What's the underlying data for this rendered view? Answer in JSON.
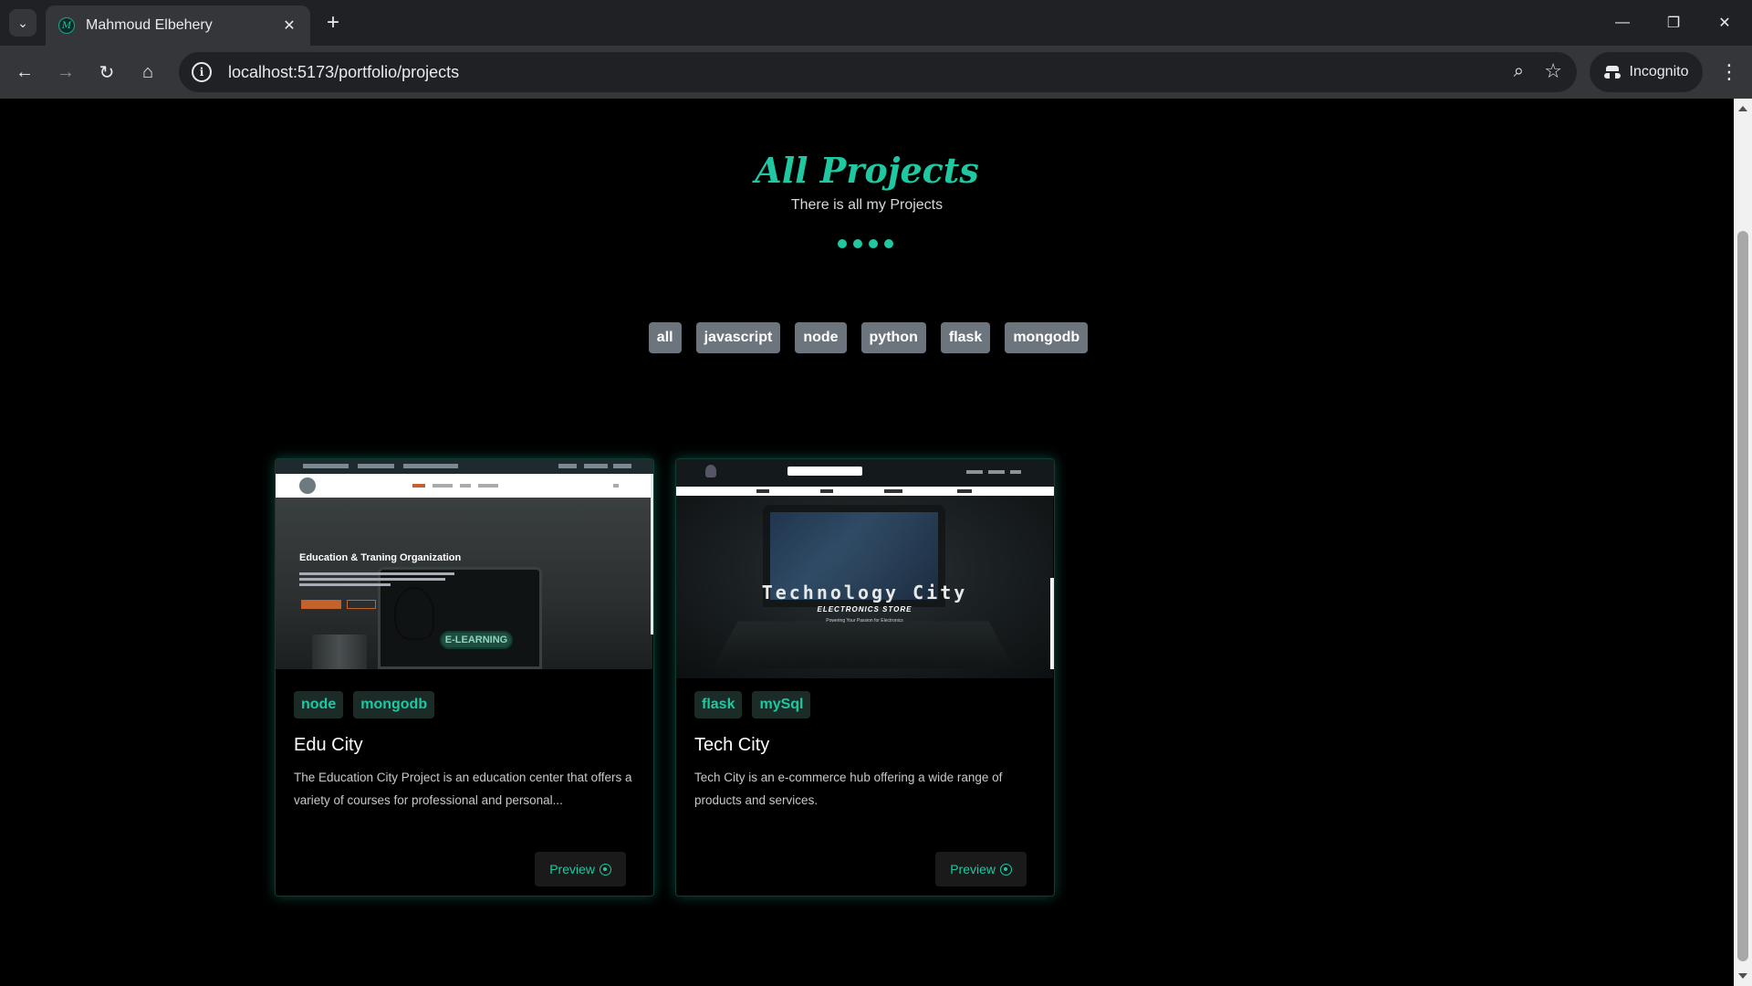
{
  "browser": {
    "tab_title": "Mahmoud Elbehery",
    "url": "localhost:5173/portfolio/projects",
    "incognito_label": "Incognito"
  },
  "page": {
    "title": "All Projects",
    "subtitle": "There is all my Projects",
    "filters": [
      "all",
      "javascript",
      "node",
      "python",
      "flask",
      "mongodb"
    ]
  },
  "projects": [
    {
      "title": "Edu City",
      "tags": [
        "node",
        "mongodb"
      ],
      "description": "The Education City Project is an education center that offers a variety of courses for professional and personal...",
      "preview_label": "Preview",
      "thumbnail": {
        "heading": "Education & Traning Organization",
        "badge": "E-LEARNING"
      }
    },
    {
      "title": "Tech City",
      "tags": [
        "flask",
        "mySql"
      ],
      "description": "Tech City is an e-commerce hub offering a wide range of products and services.",
      "preview_label": "Preview",
      "thumbnail": {
        "heading": "Technology City",
        "subheading": "ELECTRONICS STORE",
        "tagline": "Powering Your Passion for Electronics"
      }
    }
  ],
  "colors": {
    "accent": "#1fc8a0",
    "filter_bg": "#6c757d",
    "tag_bg": "#1b2b27",
    "page_bg": "#000000"
  }
}
